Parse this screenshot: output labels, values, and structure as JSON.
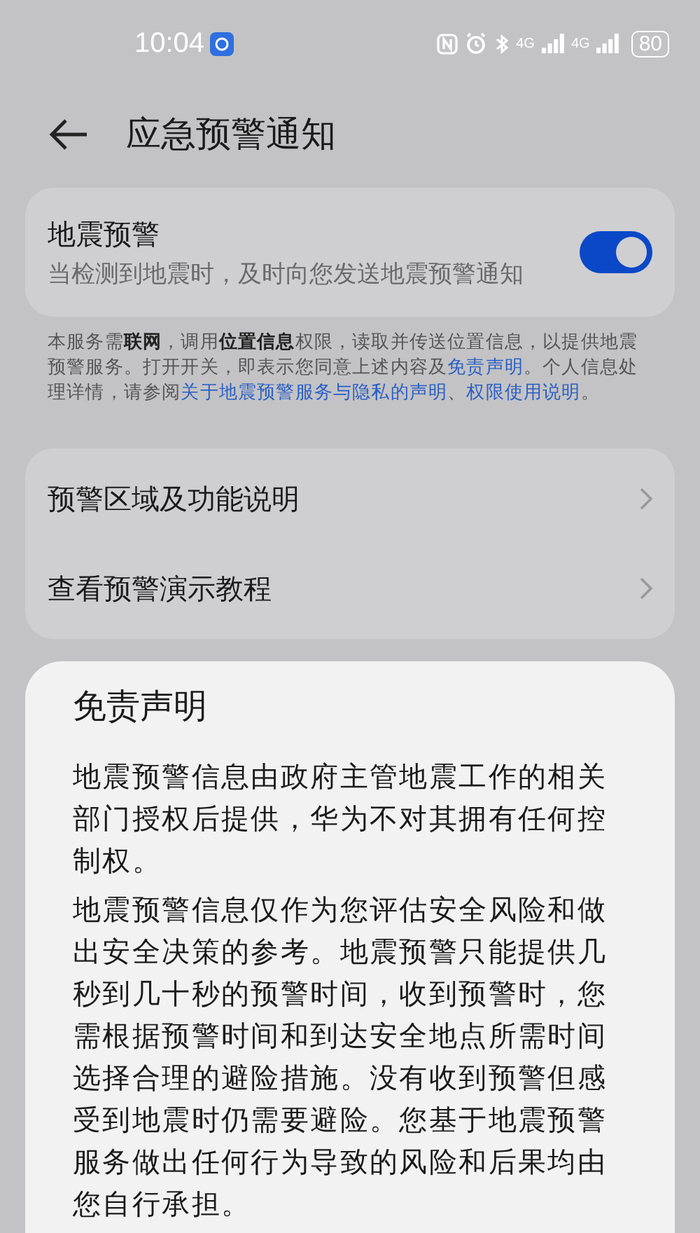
{
  "status_bar": {
    "time": "10:04",
    "network_1": "4G",
    "network_2": "4G",
    "battery": "80"
  },
  "header": {
    "title": "应急预警通知"
  },
  "setting": {
    "title": "地震预警",
    "description": "当检测到地震时，及时向您发送地震预警通知",
    "on": true
  },
  "notice": [
    {
      "kind": "plain",
      "text": "本服务需"
    },
    {
      "kind": "bold",
      "text": "联网"
    },
    {
      "kind": "plain",
      "text": "，调用"
    },
    {
      "kind": "bold",
      "text": "位置信息"
    },
    {
      "kind": "plain",
      "text": "权限，读取并传送位置信息，以提供地震预警服务。打开开关，即表示您同意上述内容及"
    },
    {
      "kind": "link",
      "text": "免责声明"
    },
    {
      "kind": "plain",
      "text": "。个人信息处理详情，请参阅"
    },
    {
      "kind": "link",
      "text": "关于地震预警服务与隐私的声明"
    },
    {
      "kind": "plain",
      "text": "、"
    },
    {
      "kind": "link",
      "text": "权限使用说明"
    },
    {
      "kind": "plain",
      "text": "。"
    }
  ],
  "menu": [
    {
      "label": "预警区域及功能说明"
    },
    {
      "label": "查看预警演示教程"
    }
  ],
  "sheet": {
    "title": "免责声明",
    "paragraphs": [
      "地震预警信息由政府主管地震工作的相关部门授权后提供，华为不对其拥有任何控制权。",
      "地震预警信息仅作为您评估安全风险和做出安全决策的参考。地震预警只能提供几秒到几十秒的预警时间，收到预警时，您需根据预警时间和到达安全地点所需时间选择合理的避险措施。没有收到预警但感受到地震时仍需要避险。您基于地震预警服务做出任何行为导致的风险和后果均由您自行承担。"
    ]
  }
}
